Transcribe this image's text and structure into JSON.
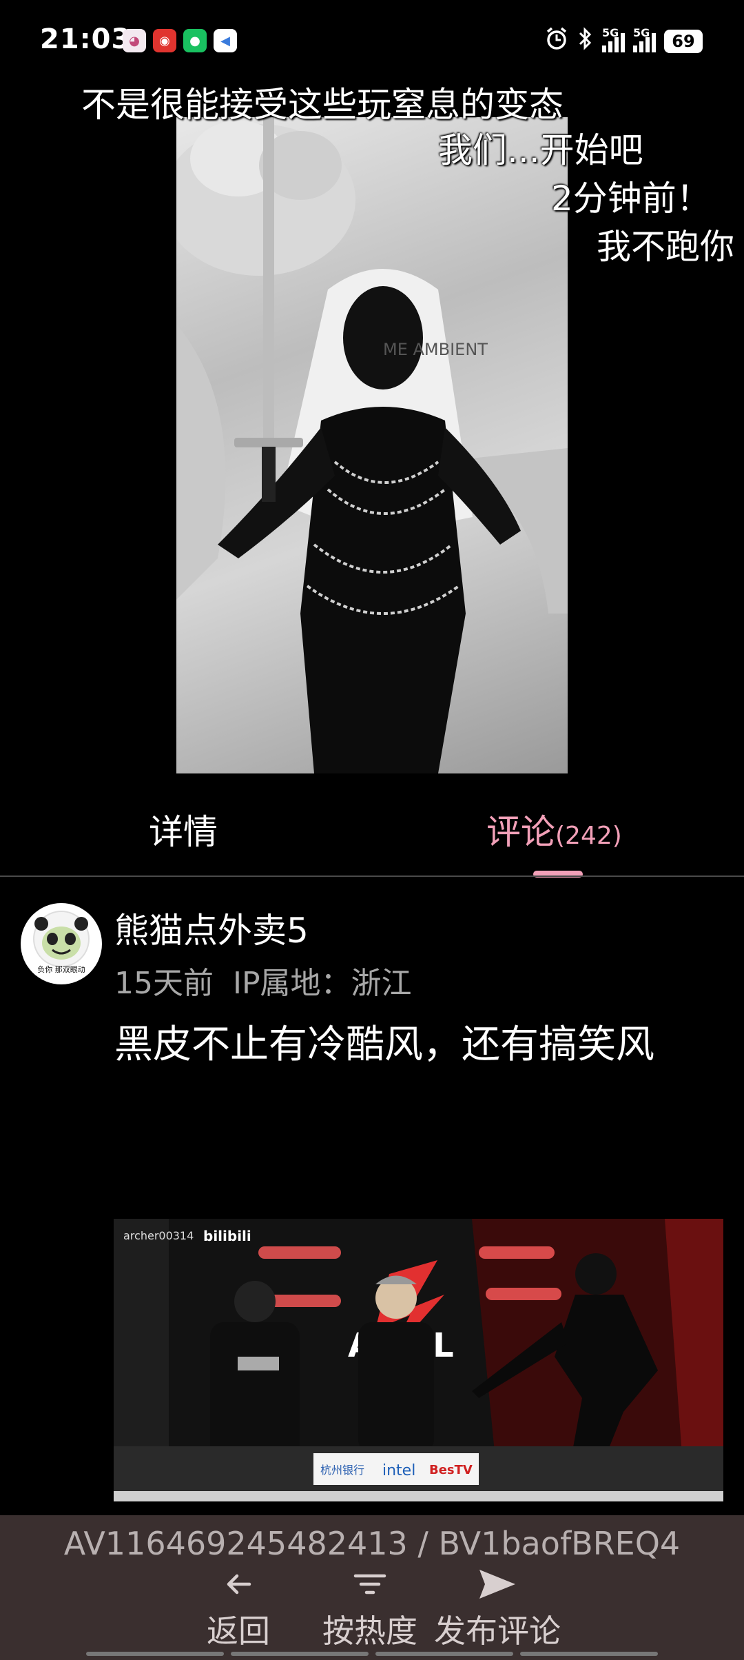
{
  "status_bar": {
    "time": "21:03",
    "network_label": "5G",
    "battery": "69",
    "notification_icons": [
      "anime-app-icon",
      "netease-music-icon",
      "wechat-icon",
      "voice-app-icon"
    ],
    "status_icons": [
      "alarm-icon",
      "bluetooth-icon",
      "signal-5g-icon",
      "signal-5g-icon-2",
      "battery-icon"
    ]
  },
  "danmaku": [
    "不是很能接受这些玩窒息的变态",
    "我们...开始吧",
    "2分钟前！",
    "我不跑你"
  ],
  "video": {
    "watermark": "ME AMBIENT"
  },
  "tabs": {
    "detail": "详情",
    "comments": "评论",
    "comments_count": "(242)"
  },
  "comment": {
    "username": "熊猫点外卖5",
    "time": "15天前",
    "ip": "IP属地：浙江",
    "text": "黑皮不止有冷酷风，还有搞笑风",
    "avatar_caption": "负你 那双眼动",
    "image": {
      "uploader": "archer00314",
      "logo": "bilibili",
      "sponsors": [
        "杭州银行",
        "intel",
        "BesTV"
      ]
    }
  },
  "bottom_bar": {
    "video_ids": "AV116469245482413 / BV1baofBREQ4",
    "back": "返回",
    "sort": "按热度",
    "post": "发布评论"
  },
  "colors": {
    "accent": "#f2a0b8",
    "background": "#000000",
    "bottom_bar": "#3a2f2f"
  }
}
